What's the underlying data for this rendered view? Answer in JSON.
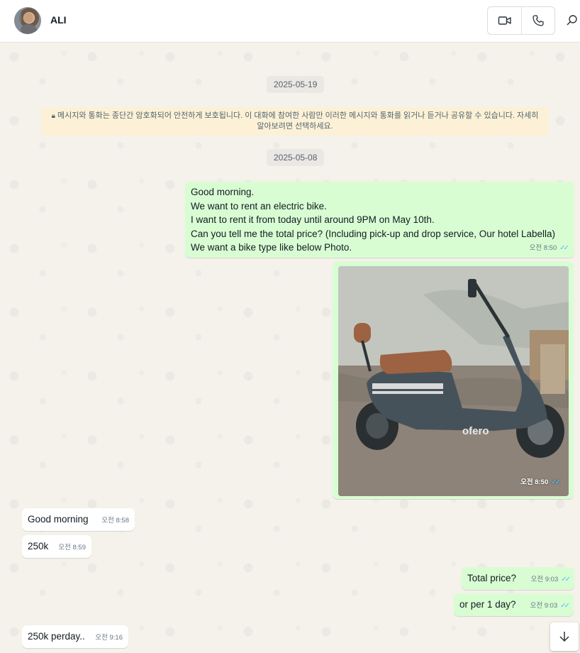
{
  "header": {
    "contact_name": "ALI",
    "avatar_icon": "user-avatar",
    "video_icon": "video-camera-icon",
    "phone_icon": "phone-icon",
    "search_icon": "search-icon"
  },
  "chat": {
    "date_1": "2025-05-19",
    "encryption_notice": "메시지와 통화는 종단간 암호화되어 안전하게 보호됩니다. 이 대화에 참여한 사람만 이러한 메시지와 통화를 읽거나 듣거나 공유할 수 있습니다. 자세히 알아보려면 선택하세요.",
    "lock_icon": "lock-icon",
    "date_2": "2025-05-08",
    "messages": [
      {
        "direction": "out",
        "text": "Good morning.\nWe want to rent an electric bike.\nI want to rent it from today until around 9PM on May 10th.\nCan you tell me the total price? (Including pick-up and drop service, Our hotel Labella)\nWe want a bike type like below Photo.",
        "time": "오전 8:50",
        "ticks": "✓✓"
      },
      {
        "direction": "out",
        "type": "image",
        "image_brand_text": "ofero",
        "time": "오전 8:50",
        "ticks": "✓✓"
      },
      {
        "direction": "in",
        "text": "Good morning",
        "time": "오전 8:58"
      },
      {
        "direction": "in",
        "text": "250k",
        "time": "오전 8:59"
      },
      {
        "direction": "out",
        "text": "Total price?",
        "time": "오전 9:03",
        "ticks": "✓✓"
      },
      {
        "direction": "out",
        "text": "or per 1 day?",
        "time": "오전 9:03",
        "ticks": "✓✓"
      },
      {
        "direction": "in",
        "text": "250k perday..",
        "time": "오전 9:16"
      }
    ]
  },
  "scroll_down_icon": "arrow-down-icon",
  "colors": {
    "outgoing_bubble": "#d9fdd3",
    "incoming_bubble": "#ffffff",
    "read_ticks": "#53bdeb",
    "notice_bg": "#fcf1d6"
  }
}
